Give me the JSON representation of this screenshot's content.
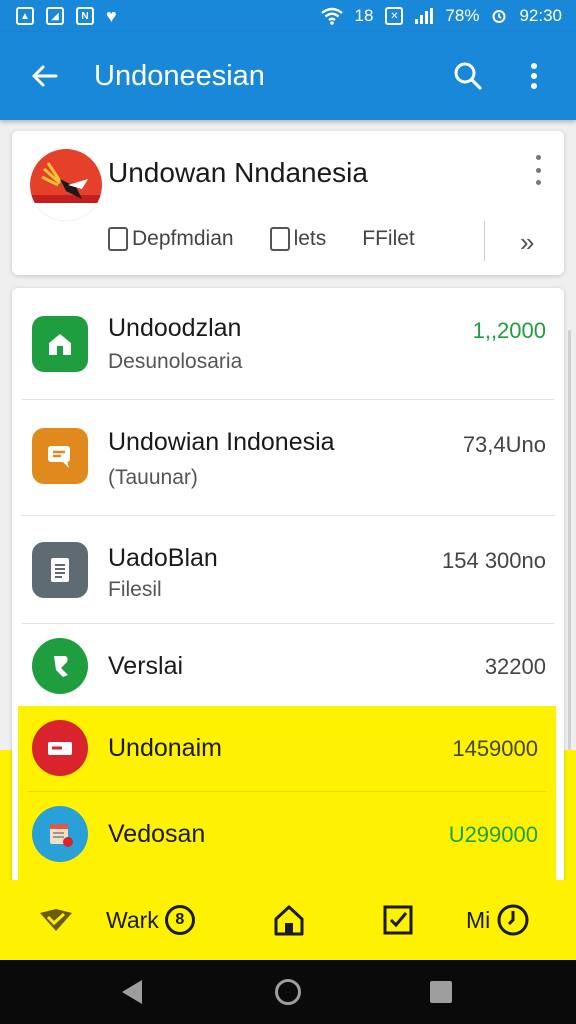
{
  "status_bar": {
    "network_label": "18",
    "battery": "78%",
    "time": "92:30"
  },
  "app_bar": {
    "title": "Undoneesian"
  },
  "header_card": {
    "title": "Undowan Nndanesia",
    "actions": [
      {
        "label": "Depfmdian",
        "icon": "document-icon"
      },
      {
        "label": "lets",
        "icon": "clipboard-icon"
      },
      {
        "label": "FFilet",
        "icon": ""
      }
    ],
    "next_glyph": "»"
  },
  "list_items": [
    {
      "title": "Undoodzlan",
      "subtitle": "Desunolosaria",
      "value": "1,,2000",
      "icon": "home-icon",
      "icon_color": "#1e9e3e",
      "value_color": "#1e9e3e"
    },
    {
      "title": "Undowian Indonesia",
      "subtitle": "(Tauunar)",
      "value": "73,4Uno",
      "icon": "chat-icon",
      "icon_color": "#e08a1e",
      "value_color": "#444444"
    },
    {
      "title": "UadoBlan",
      "subtitle": "Filesil",
      "value": "154 300no",
      "icon": "file-icon",
      "icon_color": "#5f6b73",
      "value_color": "#444444"
    },
    {
      "title": "Verslai",
      "subtitle": "",
      "value": "32200",
      "icon": "share-icon",
      "icon_color": "#1e9e3e",
      "value_color": "#444444"
    },
    {
      "title": "Undonaim",
      "subtitle": "",
      "value": "1459000",
      "icon": "card-icon",
      "icon_color": "#d9232d",
      "value_color": "#444444"
    },
    {
      "title": "Vedosan",
      "subtitle": "",
      "value": "U299000",
      "icon": "calendar-icon",
      "icon_color": "#2aa0d8",
      "value_color": "#1e9e3e"
    }
  ],
  "bottom_nav": {
    "item1_label": "Wark",
    "item1_badge": "8",
    "item4_label": "Mi"
  },
  "colors": {
    "primary": "#1a88d8",
    "highlight": "#fef200"
  }
}
